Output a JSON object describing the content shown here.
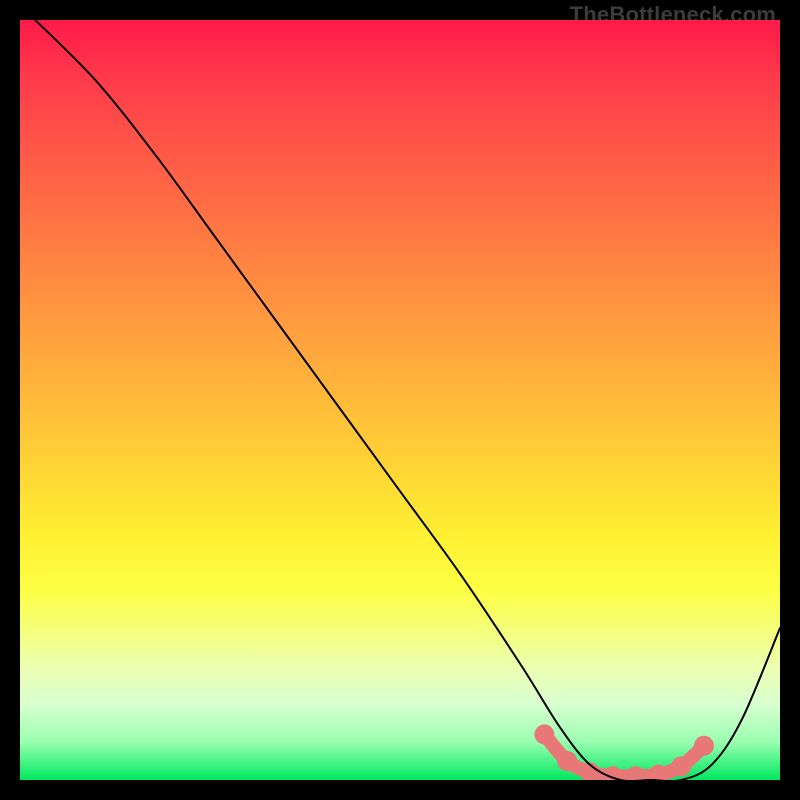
{
  "attribution": "TheBottleneck.com",
  "chart_data": {
    "type": "line",
    "title": "",
    "xlabel": "",
    "ylabel": "",
    "xlim": [
      0,
      100
    ],
    "ylim": [
      0,
      100
    ],
    "series": [
      {
        "name": "curve",
        "x": [
          2,
          10,
          18,
          26,
          34,
          42,
          50,
          58,
          66,
          71,
          75,
          79,
          83,
          87,
          91,
          95,
          100
        ],
        "y": [
          100,
          92,
          82,
          71,
          60,
          49,
          38,
          27,
          15,
          7,
          2,
          0,
          0,
          0,
          2,
          8,
          20
        ],
        "stroke": "#000000",
        "width": 2
      }
    ],
    "markers": {
      "name": "highlight-band",
      "x": [
        69,
        72,
        75,
        78,
        81,
        84,
        87,
        90
      ],
      "y": [
        6,
        2.5,
        1,
        0.5,
        0.5,
        0.7,
        1.8,
        4.5
      ],
      "color": "#e87878",
      "size": 10,
      "stroke_width": 14
    }
  }
}
